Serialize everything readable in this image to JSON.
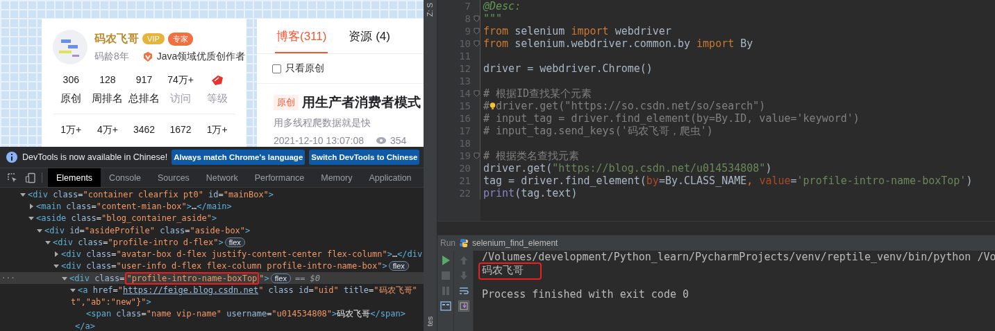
{
  "browser_page": {
    "profile": {
      "name": "码农飞哥",
      "badges": [
        {
          "kind": "vip",
          "text": "VIP"
        },
        {
          "kind": "expert",
          "text": "专家"
        }
      ],
      "age": "码龄8年",
      "certification": "Java领域优质创作者",
      "stats": [
        [
          {
            "kind": "number",
            "value": "306",
            "label": "原创",
            "muted": false
          },
          {
            "kind": "number",
            "value": "128",
            "label": "周排名",
            "muted": false
          },
          {
            "kind": "number",
            "value": "917",
            "label": "总排名",
            "muted": false
          },
          {
            "kind": "number",
            "value": "74万+",
            "label": "访问",
            "muted": true
          },
          {
            "kind": "level_icon",
            "label": "等级",
            "muted": true
          }
        ],
        [
          {
            "kind": "number",
            "value": "1万+"
          },
          {
            "kind": "number",
            "value": "4万+"
          },
          {
            "kind": "number",
            "value": "3462"
          },
          {
            "kind": "number",
            "value": "1672"
          },
          {
            "kind": "number",
            "value": "1万+"
          }
        ]
      ]
    },
    "blog_panel": {
      "tabs": [
        {
          "label": "博客(311)",
          "selected": true
        },
        {
          "label": "资源 (4)",
          "selected": false
        }
      ],
      "filter": {
        "label": "只看原创",
        "checked": false
      },
      "article": {
        "tag": "原创",
        "title": "用生产者消费者模式",
        "summary": "用多线程爬数据就是快",
        "date": "2021-12-10 13:07:08",
        "views": "354"
      }
    }
  },
  "devtools": {
    "notice": {
      "text": "DevTools is now available in Chinese!",
      "buttons": [
        "Always match Chrome's language",
        "Switch DevTools to Chinese"
      ]
    },
    "tabs": [
      {
        "label": "Elements",
        "selected": true
      },
      {
        "label": "Console",
        "selected": false
      },
      {
        "label": "Sources",
        "selected": false
      },
      {
        "label": "Network",
        "selected": false
      },
      {
        "label": "Performance",
        "selected": false
      },
      {
        "label": "Memory",
        "selected": false
      },
      {
        "label": "Application",
        "selected": false
      }
    ],
    "tree": [
      {
        "kind": "branch",
        "expanded": true,
        "selected": false,
        "lines": [
          [
            {
              "kind": "code",
              "tokens": [
                {
                  "kind": "tag",
                  "text": "<div"
                },
                {
                  "kind": "attr",
                  "text": " class"
                },
                {
                  "kind": "punct",
                  "text": "="
                },
                {
                  "kind": "value",
                  "text": "\"container clearfix pt0\""
                },
                {
                  "kind": "attr",
                  "text": " id"
                },
                {
                  "kind": "punct",
                  "text": "="
                },
                {
                  "kind": "value",
                  "text": "\"mainBox\""
                },
                {
                  "kind": "tag",
                  "text": ">"
                }
              ]
            }
          ]
        ],
        "children": [
          {
            "kind": "branch",
            "expanded": false,
            "selected": false,
            "lines": [
              [
                {
                  "kind": "code",
                  "tokens": [
                    {
                      "kind": "tag",
                      "text": "<main"
                    },
                    {
                      "kind": "attr",
                      "text": " class"
                    },
                    {
                      "kind": "punct",
                      "text": "="
                    },
                    {
                      "kind": "value",
                      "text": "\"content-mian-box\""
                    },
                    {
                      "kind": "tag",
                      "text": ">"
                    },
                    {
                      "kind": "punct",
                      "text": "…"
                    },
                    {
                      "kind": "tag",
                      "text": "</main>"
                    }
                  ]
                }
              ]
            ]
          },
          {
            "kind": "branch",
            "expanded": true,
            "selected": false,
            "lines": [
              [
                {
                  "kind": "code",
                  "tokens": [
                    {
                      "kind": "tag",
                      "text": "<aside"
                    },
                    {
                      "kind": "attr",
                      "text": " class"
                    },
                    {
                      "kind": "punct",
                      "text": "="
                    },
                    {
                      "kind": "value",
                      "text": "\"blog_container_aside\""
                    },
                    {
                      "kind": "tag",
                      "text": ">"
                    }
                  ]
                }
              ]
            ],
            "children": [
              {
                "kind": "branch",
                "expanded": true,
                "selected": false,
                "lines": [
                  [
                    {
                      "kind": "code",
                      "tokens": [
                        {
                          "kind": "tag",
                          "text": "<div"
                        },
                        {
                          "kind": "attr",
                          "text": " id"
                        },
                        {
                          "kind": "punct",
                          "text": "="
                        },
                        {
                          "kind": "value",
                          "text": "\"asideProfile\""
                        },
                        {
                          "kind": "attr",
                          "text": " class"
                        },
                        {
                          "kind": "punct",
                          "text": "="
                        },
                        {
                          "kind": "value",
                          "text": "\"aside-box\""
                        },
                        {
                          "kind": "tag",
                          "text": ">"
                        }
                      ]
                    }
                  ]
                ],
                "children": [
                  {
                    "kind": "branch",
                    "expanded": true,
                    "selected": false,
                    "lines": [
                      [
                        {
                          "kind": "code",
                          "tokens": [
                            {
                              "kind": "tag",
                              "text": "<div"
                            },
                            {
                              "kind": "attr",
                              "text": " class"
                            },
                            {
                              "kind": "punct",
                              "text": "="
                            },
                            {
                              "kind": "value",
                              "text": "\"profile-intro d-flex\""
                            },
                            {
                              "kind": "tag",
                              "text": ">"
                            }
                          ]
                        },
                        {
                          "kind": "badge",
                          "text": "flex"
                        }
                      ]
                    ],
                    "children": [
                      {
                        "kind": "branch",
                        "expanded": false,
                        "selected": false,
                        "lines": [
                          [
                            {
                              "kind": "code",
                              "tokens": [
                                {
                                  "kind": "tag",
                                  "text": "<div"
                                },
                                {
                                  "kind": "attr",
                                  "text": " class"
                                },
                                {
                                  "kind": "punct",
                                  "text": "="
                                },
                                {
                                  "kind": "value",
                                  "text": "\"avatar-box d-flex justify-content-center flex-column\""
                                },
                                {
                                  "kind": "tag",
                                  "text": ">"
                                },
                                {
                                  "kind": "punct",
                                  "text": "…"
                                },
                                {
                                  "kind": "tag",
                                  "text": "</div"
                                }
                              ]
                            }
                          ]
                        ]
                      },
                      {
                        "kind": "branch",
                        "expanded": true,
                        "selected": false,
                        "lines": [
                          [
                            {
                              "kind": "code",
                              "tokens": [
                                {
                                  "kind": "tag",
                                  "text": "<div"
                                },
                                {
                                  "kind": "attr",
                                  "text": " class"
                                },
                                {
                                  "kind": "punct",
                                  "text": "="
                                },
                                {
                                  "kind": "value",
                                  "text": "\"user-info d-flex flex-column profile-intro-name-box\""
                                },
                                {
                                  "kind": "tag",
                                  "text": ">"
                                }
                              ]
                            },
                            {
                              "kind": "badge",
                              "text": "flex"
                            }
                          ]
                        ],
                        "children": [
                          {
                            "kind": "branch",
                            "expanded": true,
                            "selected": true,
                            "marker": "···",
                            "lines": [
                              [
                                {
                                  "kind": "code",
                                  "tokens": [
                                    {
                                      "kind": "tag",
                                      "text": "<div"
                                    },
                                    {
                                      "kind": "attr",
                                      "text": " class"
                                    },
                                    {
                                      "kind": "punct",
                                      "text": "="
                                    }
                                  ]
                                },
                                {
                                  "kind": "boxed",
                                  "tokens": [
                                    {
                                      "kind": "value",
                                      "text": "\"profile-intro-name-boxTop"
                                    }
                                  ]
                                },
                                {
                                  "kind": "code",
                                  "tokens": [
                                    {
                                      "kind": "value",
                                      "text": "\""
                                    },
                                    {
                                      "kind": "tag",
                                      "text": ">"
                                    }
                                  ]
                                },
                                {
                                  "kind": "badge",
                                  "text": "flex"
                                },
                                {
                                  "kind": "hint",
                                  "text": "== $0"
                                }
                              ]
                            ],
                            "children": [
                              {
                                "kind": "branch",
                                "expanded": true,
                                "selected": false,
                                "lines": [
                                  [
                                    {
                                      "kind": "code",
                                      "tokens": [
                                        {
                                          "kind": "tag",
                                          "text": "<a"
                                        },
                                        {
                                          "kind": "attr",
                                          "text": " href"
                                        },
                                        {
                                          "kind": "punct",
                                          "text": "="
                                        },
                                        {
                                          "kind": "value",
                                          "text": "\""
                                        }
                                      ]
                                    },
                                    {
                                      "kind": "link",
                                      "text": "https://feige.blog.csdn.net"
                                    },
                                    {
                                      "kind": "code",
                                      "tokens": [
                                        {
                                          "kind": "value",
                                          "text": "\""
                                        },
                                        {
                                          "kind": "attr",
                                          "text": " class id"
                                        },
                                        {
                                          "kind": "punct",
                                          "text": "="
                                        },
                                        {
                                          "kind": "value",
                                          "text": "\"uid\""
                                        },
                                        {
                                          "kind": "attr",
                                          "text": " title"
                                        },
                                        {
                                          "kind": "punct",
                                          "text": "="
                                        },
                                        {
                                          "kind": "value",
                                          "text": "\"码农飞哥\""
                                        }
                                      ]
                                    }
                                  ],
                                  [
                                    {
                                      "kind": "code",
                                      "tokens": [
                                        {
                                          "kind": "value",
                                          "text": "t\",\"ab\":\"new\"}\""
                                        },
                                        {
                                          "kind": "tag",
                                          "text": ">"
                                        }
                                      ]
                                    }
                                  ]
                                ],
                                "children": [
                                  {
                                    "kind": "leaf",
                                    "selected": false,
                                    "lines": [
                                      [
                                        {
                                          "kind": "code",
                                          "tokens": [
                                            {
                                              "kind": "tag",
                                              "text": "<span"
                                            },
                                            {
                                              "kind": "attr",
                                              "text": " class"
                                            },
                                            {
                                              "kind": "punct",
                                              "text": "="
                                            },
                                            {
                                              "kind": "value",
                                              "text": "\"name vip-name\""
                                            },
                                            {
                                              "kind": "attr",
                                              "text": " username"
                                            },
                                            {
                                              "kind": "punct",
                                              "text": "="
                                            },
                                            {
                                              "kind": "value",
                                              "text": "\"u014534808\""
                                            },
                                            {
                                              "kind": "tag",
                                              "text": ">"
                                            },
                                            {
                                              "kind": "text",
                                              "text": "码农飞哥"
                                            },
                                            {
                                              "kind": "tag",
                                              "text": "</span>"
                                            }
                                          ]
                                        }
                                      ]
                                    ]
                                  }
                                ],
                                "close": [
                                  {
                                    "kind": "tag",
                                    "text": "</a>"
                                  }
                                ]
                              }
                            ]
                          }
                        ]
                      }
                    ]
                  }
                ]
              }
            ]
          }
        ]
      }
    ]
  },
  "pycharm": {
    "side_tabs": [
      "Z: S",
      "tes"
    ],
    "editor": {
      "lines": [
        {
          "number": "7",
          "fold": false,
          "tokens": [
            {
              "kind": "doc",
              "text": "@Desc:"
            }
          ]
        },
        {
          "number": "8",
          "fold": true,
          "tokens": [
            {
              "kind": "doc",
              "text": "\"\"\""
            }
          ]
        },
        {
          "number": "9",
          "fold": true,
          "tokens": [
            {
              "kind": "kw",
              "text": "from"
            },
            {
              "kind": "plain",
              "text": " selenium "
            },
            {
              "kind": "kw",
              "text": "import"
            },
            {
              "kind": "plain",
              "text": " webdriver"
            }
          ]
        },
        {
          "number": "10",
          "fold": true,
          "tokens": [
            {
              "kind": "kw",
              "text": "from"
            },
            {
              "kind": "plain",
              "text": " selenium.webdriver.common.by "
            },
            {
              "kind": "kw",
              "text": "import"
            },
            {
              "kind": "plain",
              "text": " By"
            }
          ]
        },
        {
          "number": "11",
          "fold": false
        },
        {
          "number": "12",
          "fold": false,
          "tokens": [
            {
              "kind": "plain",
              "text": "driver = webdriver.Chrome()"
            }
          ]
        },
        {
          "number": "13",
          "fold": false
        },
        {
          "number": "14",
          "fold": true,
          "tokens": [
            {
              "kind": "comment",
              "text": "# 根据ID查找某个元素"
            }
          ]
        },
        {
          "number": "15",
          "fold": false,
          "tokens": [
            {
              "kind": "comment",
              "text": "#"
            },
            {
              "kind": "bulb"
            },
            {
              "kind": "comment",
              "text": "driver.get(\"https://so.csdn.net/so/search\")"
            }
          ]
        },
        {
          "number": "16",
          "fold": false,
          "tokens": [
            {
              "kind": "comment",
              "text": "# input_tag = driver.find_element(by=By.ID, value='keyword')"
            }
          ]
        },
        {
          "number": "17",
          "fold": false,
          "tokens": [
            {
              "kind": "comment",
              "text": "# input_tag.send_keys('码农飞哥，爬虫')"
            }
          ]
        },
        {
          "number": "18",
          "fold": false
        },
        {
          "number": "19",
          "fold": true,
          "tokens": [
            {
              "kind": "comment",
              "text": "# 根据类名查找元素"
            }
          ]
        },
        {
          "number": "20",
          "fold": false,
          "tokens": [
            {
              "kind": "plain",
              "text": "driver.get("
            },
            {
              "kind": "string",
              "text": "\"https://blog.csdn.net/u014534808\""
            },
            {
              "kind": "plain",
              "text": ")"
            }
          ]
        },
        {
          "number": "21",
          "fold": false,
          "tokens": [
            {
              "kind": "plain",
              "text": "tag = driver.find_element("
            },
            {
              "kind": "param",
              "text": "by"
            },
            {
              "kind": "plain",
              "text": "=By.CLASS_NAME"
            },
            {
              "kind": "kw",
              "text": ", "
            },
            {
              "kind": "param",
              "text": "value"
            },
            {
              "kind": "plain",
              "text": "="
            },
            {
              "kind": "string",
              "text": "'profile-intro-name-boxTop'"
            },
            {
              "kind": "plain",
              "text": ")"
            }
          ]
        },
        {
          "number": "22",
          "fold": false,
          "tokens": [
            {
              "kind": "builtin",
              "text": "print"
            },
            {
              "kind": "plain",
              "text": "(tag.text)"
            }
          ]
        }
      ]
    },
    "run": {
      "label": "Run",
      "config": "selenium_find_element",
      "output": [
        {
          "kind": "command",
          "text": "/Volumes/development/Python_learn/PycharmProjects/venv/reptile_venv/bin/python /Vo"
        },
        {
          "kind": "boxed",
          "text": "码农飞哥"
        },
        {
          "kind": "status",
          "text": "Process finished with exit code 0"
        }
      ]
    }
  }
}
